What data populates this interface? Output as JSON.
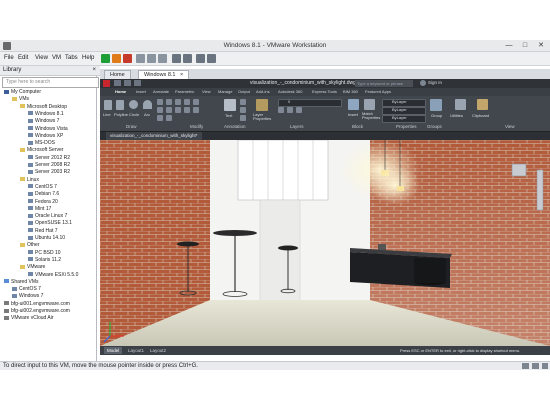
{
  "window": {
    "title": "Windows 8.1 - VMware Workstation",
    "min": "—",
    "max": "□",
    "close": "✕"
  },
  "menu": [
    "File",
    "Edit",
    "View",
    "VM",
    "Tabs",
    "Help"
  ],
  "library": {
    "title": "Library",
    "close": "×",
    "search_placeholder": "Type here to search",
    "tree": [
      {
        "label": "My Computer",
        "level": 0,
        "icon": "pc"
      },
      {
        "label": "VMs",
        "level": 1,
        "icon": "folder"
      },
      {
        "label": "Microsoft Desktop",
        "level": 2,
        "icon": "folder"
      },
      {
        "label": "Windows 8.1",
        "level": 3,
        "icon": "vm"
      },
      {
        "label": "Windows 7",
        "level": 3,
        "icon": "vm"
      },
      {
        "label": "Windows Vista",
        "level": 3,
        "icon": "vm"
      },
      {
        "label": "Windows XP",
        "level": 3,
        "icon": "vm"
      },
      {
        "label": "MS-DOS",
        "level": 3,
        "icon": "vm"
      },
      {
        "label": "Microsoft Server",
        "level": 2,
        "icon": "folder"
      },
      {
        "label": "Server 2012 R2",
        "level": 3,
        "icon": "vm"
      },
      {
        "label": "Server 2008 R2",
        "level": 3,
        "icon": "vm"
      },
      {
        "label": "Server 2003 R2",
        "level": 3,
        "icon": "vm"
      },
      {
        "label": "Linux",
        "level": 2,
        "icon": "folder"
      },
      {
        "label": "CentOS 7",
        "level": 3,
        "icon": "vm"
      },
      {
        "label": "Debian 7.6",
        "level": 3,
        "icon": "vm"
      },
      {
        "label": "Fedora 20",
        "level": 3,
        "icon": "vm"
      },
      {
        "label": "Mint 17",
        "level": 3,
        "icon": "vm"
      },
      {
        "label": "Oracle Linux 7",
        "level": 3,
        "icon": "vm"
      },
      {
        "label": "OpenSUSE 13.1",
        "level": 3,
        "icon": "vm"
      },
      {
        "label": "Red Hat 7",
        "level": 3,
        "icon": "vm"
      },
      {
        "label": "Ubuntu 14.10",
        "level": 3,
        "icon": "vm"
      },
      {
        "label": "Other",
        "level": 2,
        "icon": "folder"
      },
      {
        "label": "PC BSD 10",
        "level": 3,
        "icon": "vm"
      },
      {
        "label": "Solaris 11.2",
        "level": 3,
        "icon": "vm"
      },
      {
        "label": "VMware",
        "level": 2,
        "icon": "folder"
      },
      {
        "label": "VMware ESXi 5.5.0",
        "level": 3,
        "icon": "vm"
      },
      {
        "label": "Shared VMs",
        "level": 0,
        "icon": "shared"
      },
      {
        "label": "CentOS 7",
        "level": 1,
        "icon": "vm"
      },
      {
        "label": "Windows 7",
        "level": 1,
        "icon": "vm"
      },
      {
        "label": "bfg-ui001.engvmware.com",
        "level": 0,
        "icon": "server"
      },
      {
        "label": "bfg-ui002.engvmware.com",
        "level": 0,
        "icon": "server"
      },
      {
        "label": "VMware vCloud Air",
        "level": 0,
        "icon": "server"
      }
    ]
  },
  "tabs": [
    {
      "label": "Home",
      "active": false
    },
    {
      "label": "Windows 8.1",
      "active": true
    }
  ],
  "autocad": {
    "file_title": "visualization_-_condominium_with_skylight.dwg",
    "search_placeholder": "Type a keyword or phrase",
    "sign_in": "Sign In",
    "ribbon_tabs": [
      "Home",
      "Insert",
      "Annotate",
      "Parametric",
      "View",
      "Manage",
      "Output",
      "Add-ins",
      "Autodesk 360",
      "Express Tools",
      "BIM 360",
      "Featured Apps"
    ],
    "draw_tools": [
      "Line",
      "Polyline",
      "Circle",
      "Arc"
    ],
    "panels": [
      "Draw",
      "Modify",
      "Annotation",
      "Layers",
      "Block",
      "Properties",
      "Groups",
      "Utilities",
      "Clipboard",
      "View"
    ],
    "tools": [
      "Text",
      "Layer Properties",
      "Insert",
      "Match Properties",
      "Group",
      "Utilities",
      "Clipboard"
    ],
    "bylayer": [
      "ByLayer",
      "ByLayer",
      "ByLayer"
    ],
    "layer_name": "0",
    "document_tab": "visualization_-_condominium_with_skylight*",
    "layout_tabs": [
      "Model",
      "Layout1",
      "Layout2"
    ],
    "command_prompt": "Press ESC or ENTER to exit, or right-click to display shortcut menu."
  },
  "status_bar": "To direct input to this VM, move the mouse pointer inside or press Ctrl+G.",
  "colors": {
    "vmware_chrome": "#e9eaec",
    "acad_dark": "#42474e",
    "brick": "#b25a3a",
    "floor": "#d9d7c4"
  }
}
